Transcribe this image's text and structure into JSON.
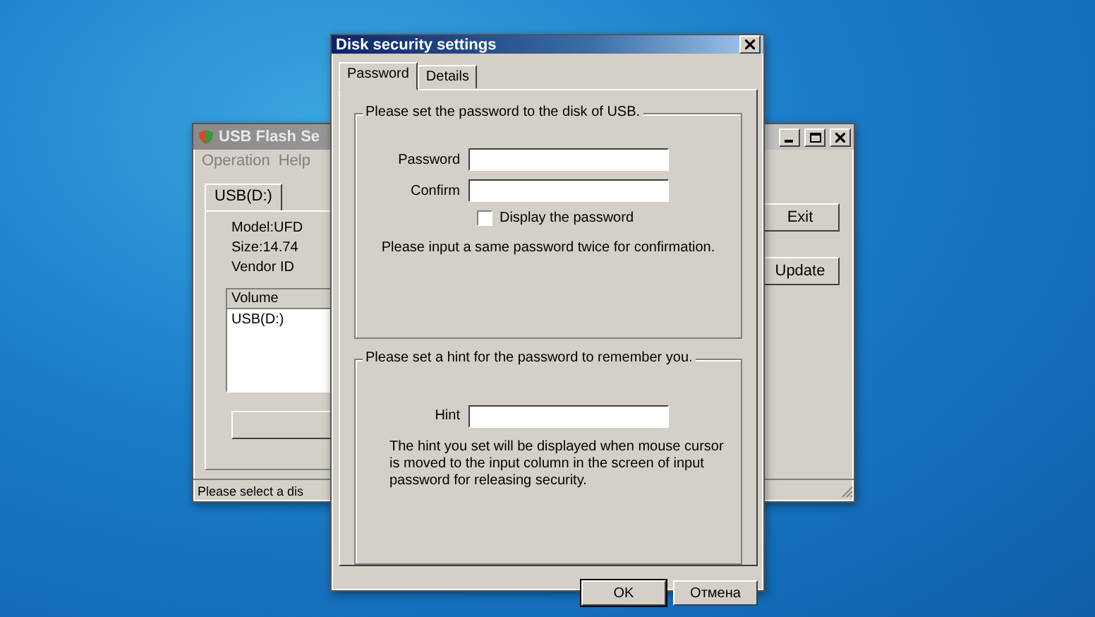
{
  "back_window": {
    "title": "USB Flash Se",
    "menu": [
      "Operation",
      "Help"
    ],
    "tabs": [
      {
        "label": "USB(D:)",
        "selected": true
      }
    ],
    "info": [
      "Model:UFD",
      "Size:14.74",
      "Vendor ID"
    ],
    "list": {
      "columns": [
        "Volume"
      ],
      "rows": [
        "USB(D:)"
      ]
    },
    "buttons": [
      "Exit",
      "Update"
    ],
    "status_bar": "Please select a dis"
  },
  "dialog": {
    "title": "Disk security settings",
    "tabs": [
      {
        "label": "Password",
        "selected": true
      },
      {
        "label": "Details",
        "selected": false
      }
    ],
    "password_group": {
      "legend": "Please set the password to the disk of USB.",
      "fields": [
        {
          "label": "Password"
        },
        {
          "label": "Confirm"
        }
      ],
      "show_password": {
        "label": "Display the password",
        "checked": false
      },
      "note": "Please input a same password twice for confirmation."
    },
    "hint_group": {
      "legend": "Please set a hint for the password to remember you.",
      "field": {
        "label": "Hint"
      },
      "note": "The hint you set will be displayed when mouse cursor is moved to the input column in the screen of input password for releasing security."
    },
    "buttons": [
      {
        "label": "OK",
        "default": true
      },
      {
        "label": "Отмена",
        "default": false
      }
    ]
  }
}
